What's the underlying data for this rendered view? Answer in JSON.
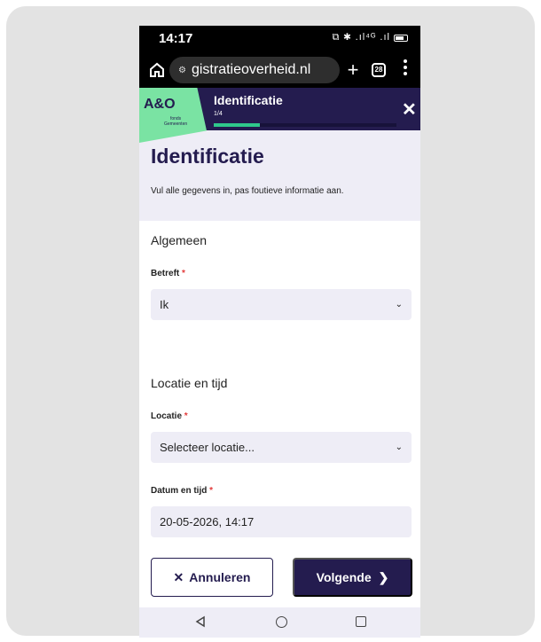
{
  "status_bar": {
    "time": "14:17",
    "icons_text": "⧉ ✱ .ıl⁴ᴳ .ıl"
  },
  "browser": {
    "url": "gistratieoverheid.nl",
    "tab_count": "28"
  },
  "header": {
    "logo_text": "A&O",
    "logo_sub_1": "fonds",
    "logo_sub_2": "Gemeenten",
    "title": "Identificatie",
    "step": "1/4",
    "progress": 0.25
  },
  "intro": {
    "title": "Identificatie",
    "description": "Vul alle gegevens in, pas foutieve informatie aan."
  },
  "form": {
    "section_general": "Algemeen",
    "betreft_label": "Betreft",
    "betreft_value": "Ik",
    "section_location": "Locatie en tijd",
    "locatie_label": "Locatie",
    "locatie_placeholder": "Selecteer locatie...",
    "datum_label": "Datum en tijd",
    "datum_value": "20-05-2026, 14:17",
    "required_marker": "*"
  },
  "actions": {
    "cancel_label": "Annuleren",
    "next_label": "Volgende"
  },
  "colors": {
    "primary": "#241c4f",
    "accent": "#7ae3a3",
    "progress": "#2fc88c",
    "field_bg": "#eeedf6"
  }
}
